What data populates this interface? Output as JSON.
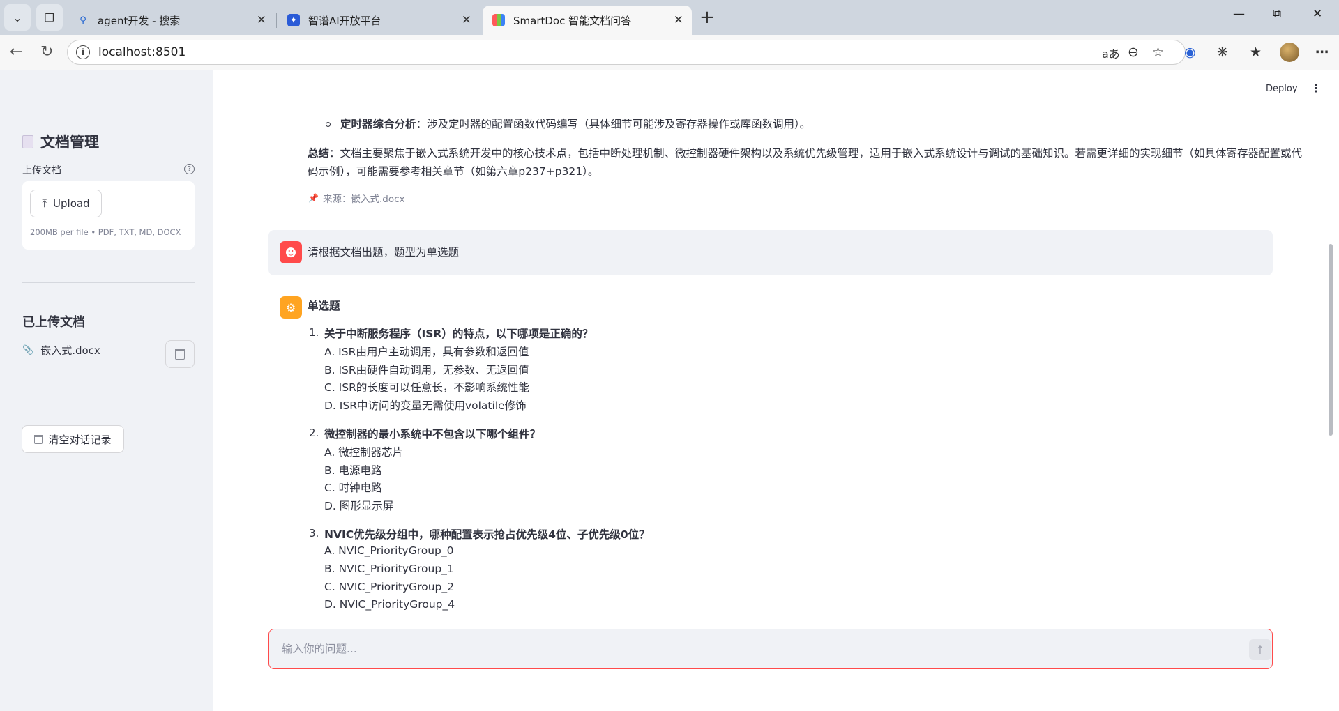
{
  "browser": {
    "tabs": [
      {
        "title": "agent开发 - 搜索",
        "icon": "search-icon"
      },
      {
        "title": "智谱AI开放平台",
        "icon": "zhipu-logo-icon"
      },
      {
        "title": "SmartDoc 智能文档问答",
        "icon": "smartdoc-logo-icon",
        "active": true
      }
    ],
    "url": "localhost:8501"
  },
  "sidebar": {
    "title": "文档管理",
    "upload_label": "上传文档",
    "upload_button": "Upload",
    "upload_hint": "200MB per file • PDF, TXT, MD, DOCX",
    "uploaded_title": "已上传文档",
    "files": [
      {
        "name": "嵌入式.docx"
      }
    ],
    "clear_button": "清空对话记录"
  },
  "toolbar": {
    "deploy_label": "Deploy"
  },
  "chat": {
    "prev_answer": {
      "bullet_bold": "定时器综合分析",
      "bullet_text": "：涉及定时器的配置函数代码编写（具体细节可能涉及寄存器操作或库函数调用）。",
      "summary_bold": "总结",
      "summary_text": "：文档主要聚焦于嵌入式系统开发中的核心技术点，包括中断处理机制、微控制器硬件架构以及系统优先级管理，适用于嵌入式系统设计与调试的基础知识。若需更详细的实现细节（如具体寄存器配置或代码示例），可能需要参考相关章节（如第六章p237+p321）。",
      "source": "来源：嵌入式.docx"
    },
    "user_message": "请根据文档出题，题型为单选题",
    "bot_heading": "单选题",
    "questions": [
      {
        "num": "1.",
        "title": "关于中断服务程序（ISR）的特点，以下哪项是正确的？",
        "options": [
          "A. ISR由用户主动调用，具有参数和返回值",
          "B. ISR由硬件自动调用，无参数、无返回值",
          "C. ISR的长度可以任意长，不影响系统性能",
          "D. ISR中访问的变量无需使用volatile修饰"
        ]
      },
      {
        "num": "2.",
        "title": "微控制器的最小系统中不包含以下哪个组件？",
        "options": [
          "A. 微控制器芯片",
          "B. 电源电路",
          "C. 时钟电路",
          "D. 图形显示屏"
        ]
      },
      {
        "num": "3.",
        "title": "NVIC优先级分组中，哪种配置表示抢占优先级4位、子优先级0位？",
        "options": [
          "A. NVIC_PriorityGroup_0",
          "B. NVIC_PriorityGroup_1",
          "C. NVIC_PriorityGroup_2",
          "D. NVIC_PriorityGroup_4"
        ]
      }
    ],
    "input_placeholder": "输入你的问题..."
  },
  "colors": {
    "accent": "#ff4b4b",
    "bot_avatar": "#ffa421",
    "sidebar_bg": "#f0f2f6"
  }
}
